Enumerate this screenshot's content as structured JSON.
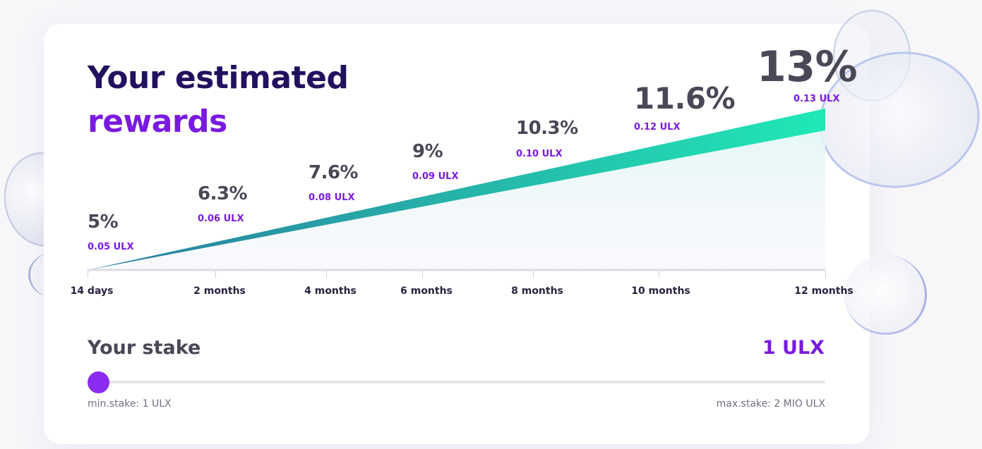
{
  "title": {
    "line1": "Your estimated",
    "line2": "rewards"
  },
  "chart_data": {
    "type": "area",
    "points": [
      {
        "period": "14 days",
        "rate_pct": 5,
        "rate_label": "5%",
        "reward": "0.05 ULX"
      },
      {
        "period": "2 months",
        "rate_pct": 6.3,
        "rate_label": "6.3%",
        "reward": "0.06 ULX"
      },
      {
        "period": "4 months",
        "rate_pct": 7.6,
        "rate_label": "7.6%",
        "reward": "0.08 ULX"
      },
      {
        "period": "6 months",
        "rate_pct": 9,
        "rate_label": "9%",
        "reward": "0.09 ULX"
      },
      {
        "period": "8 months",
        "rate_pct": 10.3,
        "rate_label": "10.3%",
        "reward": "0.10 ULX"
      },
      {
        "period": "10 months",
        "rate_pct": 11.6,
        "rate_label": "11.6%",
        "reward": "0.12 ULX"
      },
      {
        "period": "12 months",
        "rate_pct": 13,
        "rate_label": "13%",
        "reward": "0.13 ULX"
      }
    ],
    "gradient_colors": [
      "#2b7d9e",
      "#20e8b5"
    ],
    "grid": false
  },
  "stake": {
    "label": "Your stake",
    "value": "1 ULX",
    "min_label": "min.stake: 1 ULX",
    "max_label": "max.stake: 2 MIO ULX",
    "slider_fraction": 0
  },
  "colors": {
    "heading": "#22115e",
    "accent": "#7a1ae0",
    "text": "#4a4757",
    "thumb": "#8a2cf2"
  }
}
